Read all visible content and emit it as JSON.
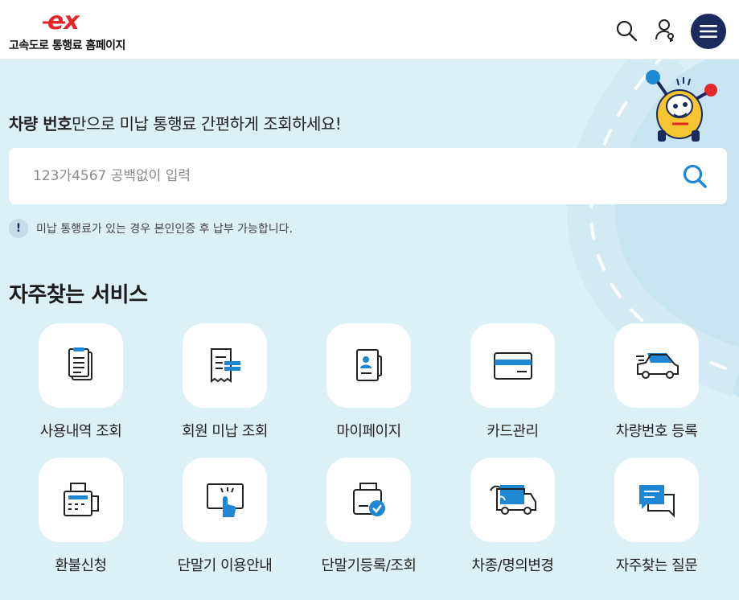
{
  "header": {
    "logo_text": "고속도로 통행료 홈페이지",
    "logo_mark": "ex"
  },
  "intro": {
    "bold": "차량 번호",
    "rest": "만으로 미납 통행료 간편하게 조회하세요!"
  },
  "search": {
    "placeholder": "123가4567 공백없이 입력",
    "value": ""
  },
  "notice": {
    "mark": "!",
    "text": "미납 통행료가 있는 경우 본인인증 후 납부 가능합니다."
  },
  "services": {
    "title": "자주찾는 서비스",
    "items": [
      {
        "label": "사용내역 조회",
        "icon": "document-list-icon"
      },
      {
        "label": "회원 미납 조회",
        "icon": "receipt-icon"
      },
      {
        "label": "마이페이지",
        "icon": "profile-card-icon"
      },
      {
        "label": "카드관리",
        "icon": "credit-card-icon"
      },
      {
        "label": "차량번호 등록",
        "icon": "car-register-icon"
      },
      {
        "label": "환불신청",
        "icon": "refund-printer-icon"
      },
      {
        "label": "단말기 이용안내",
        "icon": "touch-terminal-icon"
      },
      {
        "label": "단말기등록/조회",
        "icon": "terminal-check-icon"
      },
      {
        "label": "차종/명의변경",
        "icon": "truck-change-icon"
      },
      {
        "label": "자주찾는 질문",
        "icon": "faq-chat-icon"
      }
    ]
  },
  "colors": {
    "navy": "#1b2a5c",
    "accent_blue": "#1e88d4",
    "brand_red": "#e4262c",
    "background": "#dcf0f7"
  }
}
